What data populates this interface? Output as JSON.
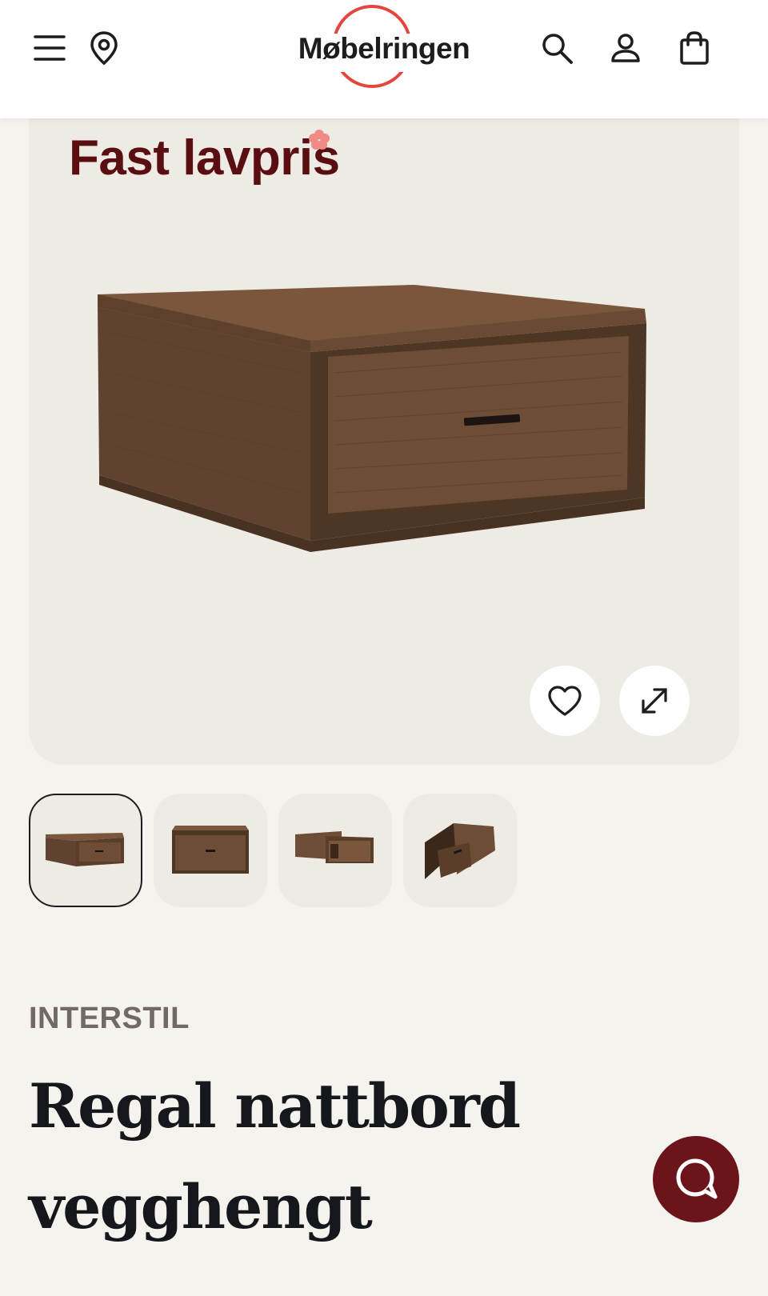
{
  "header": {
    "logo_text": "Møbelringen",
    "icons": [
      "menu-icon",
      "location-pin-icon",
      "search-icon",
      "user-icon",
      "shopping-bag-icon"
    ]
  },
  "hero": {
    "badge": "Fast lavpris"
  },
  "thumbnails": [
    "thumb-front-angled",
    "thumb-front",
    "thumb-drawer-open",
    "thumb-closeup"
  ],
  "product": {
    "brand": "INTERSTIL",
    "title": "Regal nattbord vegghengt"
  },
  "colors": {
    "logo_ring": "#e4453f",
    "badge": "#5a0e12",
    "chat_button": "#6b1419",
    "page_bg": "#f6f2ee",
    "card_bg": "#eeeae4"
  }
}
